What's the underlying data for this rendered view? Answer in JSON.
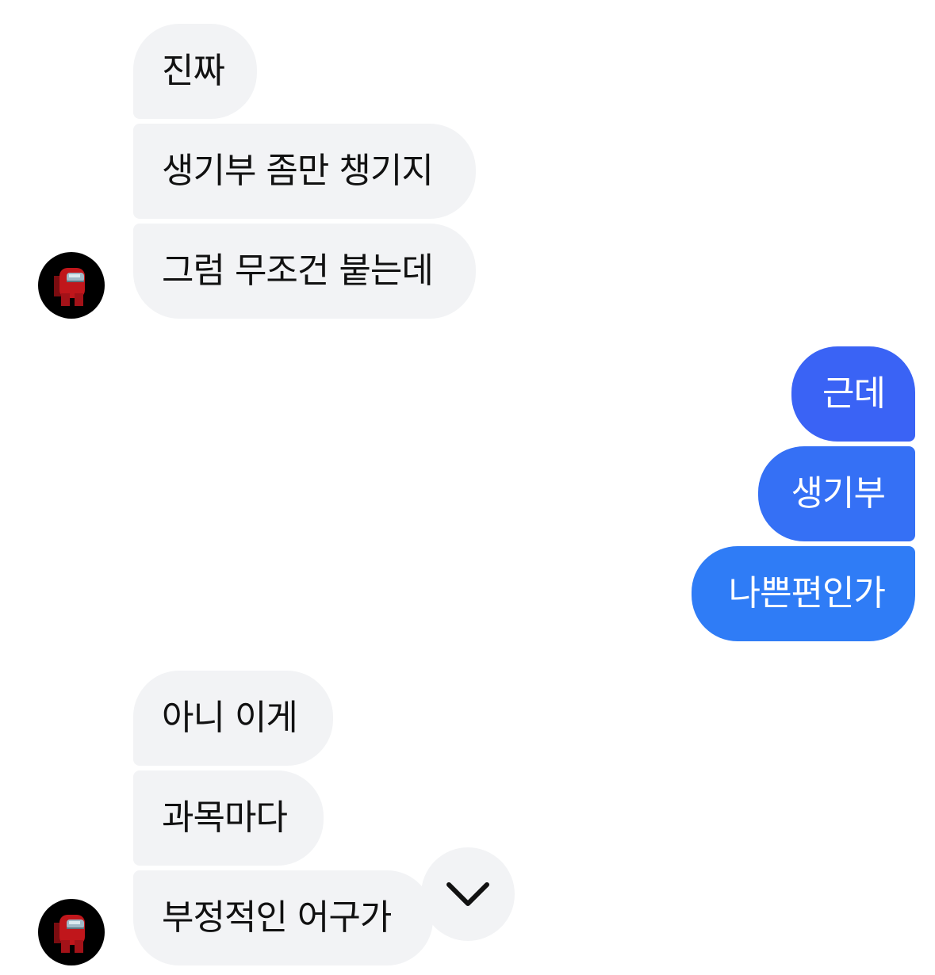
{
  "colors": {
    "incoming_bubble": "#f2f3f5",
    "outgoing_gradient_top": "#3b5ff5",
    "outgoing_gradient_bottom": "#2f7cf6",
    "avatar_bg": "#000000",
    "avatar_character": "#c0161b"
  },
  "conversation": {
    "group1": {
      "avatar_icon": "among-us-red-crewmate",
      "messages": [
        "진짜",
        "생기부 좀만 챙기지",
        "그럼 무조건 붙는데"
      ]
    },
    "group2": {
      "messages": [
        "근데",
        "생기부",
        "나쁜편인가"
      ]
    },
    "group3": {
      "avatar_icon": "among-us-red-crewmate",
      "messages": [
        "아니 이게",
        "과목마다",
        "부정적인 어구가"
      ]
    }
  },
  "scroll_button": {
    "icon": "chevron-down-icon"
  }
}
